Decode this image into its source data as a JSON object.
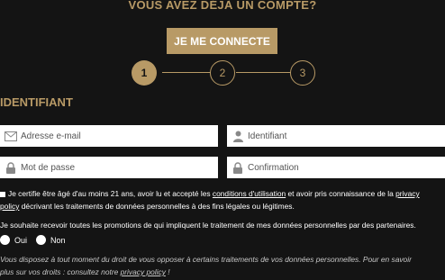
{
  "header": {
    "title": "VOUS AVEZ DÉJÀ UN COMPTE?"
  },
  "login_button": {
    "label": "JE ME CONNECTE"
  },
  "steps": [
    {
      "number": "1",
      "active": true
    },
    {
      "number": "2",
      "active": false
    },
    {
      "number": "3",
      "active": false
    }
  ],
  "section": {
    "title": "IDENTIFIANT"
  },
  "fields": {
    "email": {
      "placeholder": "Adresse e-mail"
    },
    "identifiant": {
      "placeholder": "Identifiant"
    },
    "password": {
      "placeholder": "Mot de passe"
    },
    "confirmation": {
      "placeholder": "Confirmation"
    }
  },
  "consent": {
    "line1_part1": "Je certifie être âgé d'au moins 21 ans, avoir lu et accepté les ",
    "line1_link": "conditions d'utilisation",
    "line1_part2": " et avoir pris connaissance de la ",
    "line1_link2": "privacy",
    "line2_link": "policy",
    "line2_rest": " décrivant les traitements de données personnelles à des fins légales ou légitimes."
  },
  "promotions": {
    "text": "Je souhaite recevoir toutes les promotions de qui impliquent le traitement de mes données personnelles par des partenaires.",
    "options": [
      "Oui",
      "Non"
    ]
  },
  "rights": {
    "line1": "Vous disposez à tout moment du droit de vous opposer à certains traitements de vos données personnelles. Pour en savoir",
    "line2_text": "plus sur vos droits : consultez notre ",
    "line2_link": "privacy policy",
    "line2_end": " !"
  },
  "colors": {
    "accent": "#b89a66",
    "background": "#141414"
  }
}
